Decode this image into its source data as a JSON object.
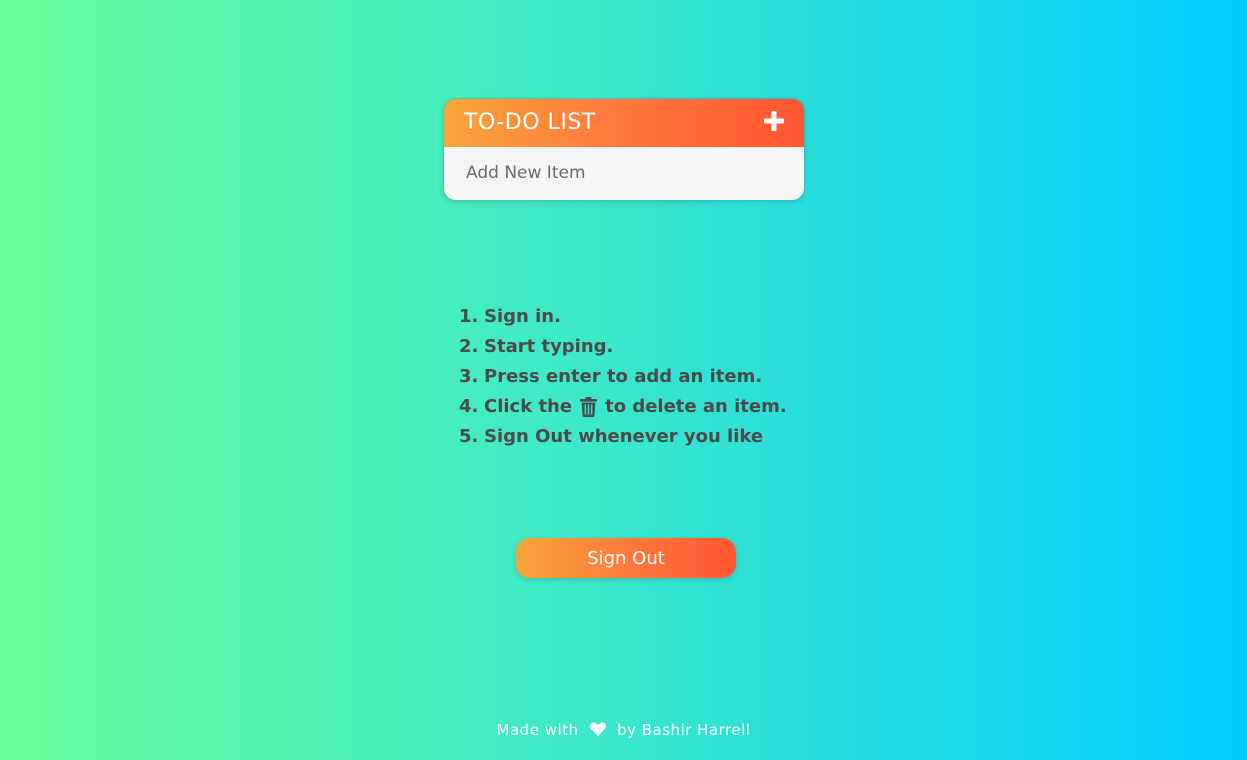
{
  "card": {
    "title": "TO-DO LIST",
    "add_icon": "plus-icon",
    "input_placeholder": "Add New Item",
    "input_value": ""
  },
  "instructions": [
    {
      "num": "1.",
      "text": "Sign in."
    },
    {
      "num": "2.",
      "text": "Start typing."
    },
    {
      "num": "3.",
      "text": "Press enter to add an item."
    },
    {
      "num": "4.",
      "before": "Click the",
      "icon": "trash-icon",
      "after": "to delete an item."
    },
    {
      "num": "5.",
      "text": "Sign Out whenever you like"
    }
  ],
  "signout_label": "Sign Out",
  "footer": {
    "before": "Made with",
    "icon": "heart-icon",
    "after": "by Bashir Harrell"
  },
  "colors": {
    "bg_left": "#66ff99",
    "bg_right": "#00ccff",
    "accent_start": "#f8a53a",
    "accent_end": "#ff5533",
    "text_dark": "#4a4a4a"
  }
}
